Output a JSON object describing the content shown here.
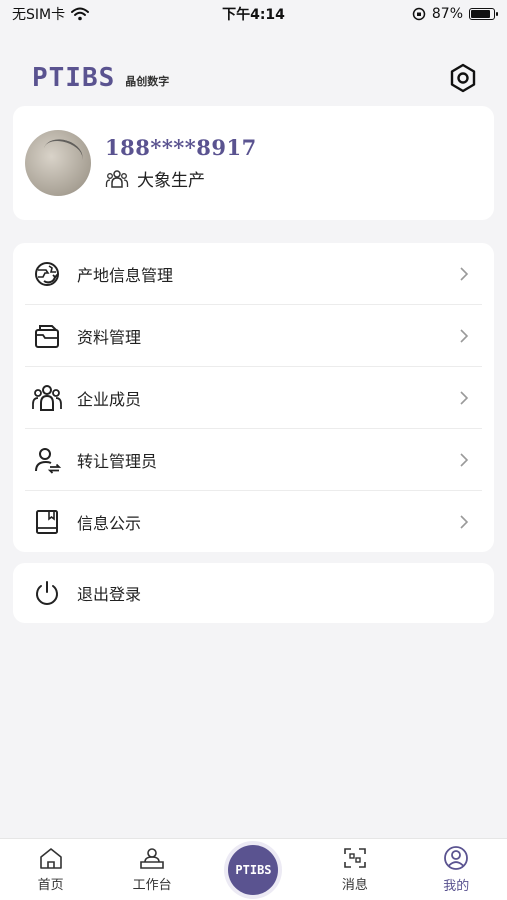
{
  "status_bar": {
    "carrier": "无SIM卡",
    "time": "下午4:14",
    "battery": "87%",
    "battery_level": 0.87
  },
  "header": {
    "logo": "PTIBS",
    "logo_sub": "晶创数字",
    "settings_icon": "settings-hex-icon"
  },
  "profile": {
    "phone": "188****8917",
    "company": "大象生产",
    "company_icon": "team-icon"
  },
  "menu": {
    "items": [
      {
        "label": "产地信息管理",
        "icon": "globe-refresh-icon"
      },
      {
        "label": "资料管理",
        "icon": "folder-icon"
      },
      {
        "label": "企业成员",
        "icon": "members-icon"
      },
      {
        "label": "转让管理员",
        "icon": "transfer-user-icon"
      },
      {
        "label": "信息公示",
        "icon": "book-icon"
      }
    ]
  },
  "logout": {
    "label": "退出登录",
    "icon": "power-icon"
  },
  "tabbar": {
    "tabs": [
      {
        "label": "首页",
        "icon": "home-icon"
      },
      {
        "label": "工作台",
        "icon": "workbench-icon"
      },
      {
        "label": "PTIBS",
        "icon": "center-logo"
      },
      {
        "label": "消息",
        "icon": "scan-icon"
      },
      {
        "label": "我的",
        "icon": "user-icon"
      }
    ],
    "active_index": 4,
    "accent_color": "#5a5390"
  }
}
